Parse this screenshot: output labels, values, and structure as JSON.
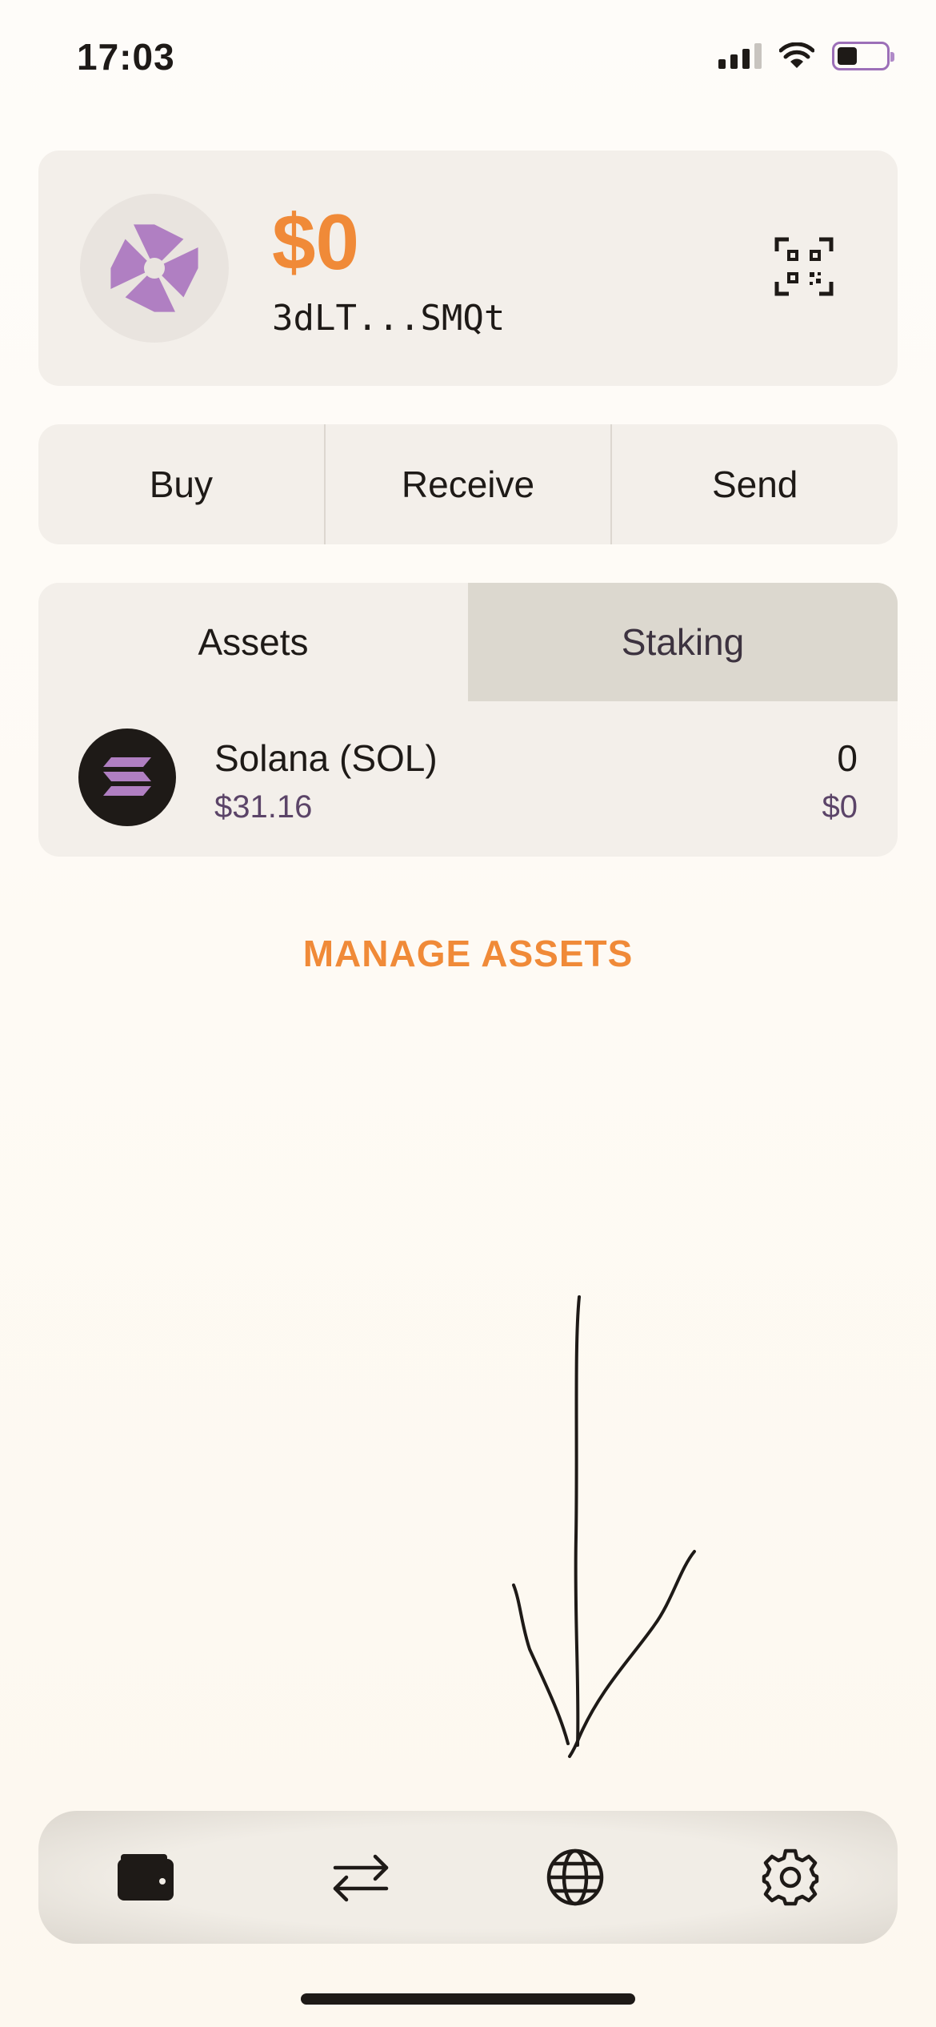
{
  "status_bar": {
    "time": "17:03"
  },
  "wallet": {
    "balance": "$0",
    "address": "3dLT...SMQt"
  },
  "actions": {
    "buy": "Buy",
    "receive": "Receive",
    "send": "Send"
  },
  "tabs": {
    "assets": "Assets",
    "staking": "Staking"
  },
  "assets": [
    {
      "name": "Solana (SOL)",
      "price": "$31.16",
      "amount": "0",
      "value": "$0"
    }
  ],
  "manage_assets": "MANAGE ASSETS",
  "colors": {
    "accent": "#f08a38",
    "avatar": "#b07fc2",
    "secondary_text": "#5b4468"
  },
  "icons": {
    "avatar": "pinwheel-avatar-icon",
    "qr": "qr-code-icon",
    "sol": "solana-icon",
    "tab_wallet": "wallet-icon",
    "tab_swap": "swap-arrows-icon",
    "tab_browser": "globe-icon",
    "tab_settings": "gear-icon"
  }
}
